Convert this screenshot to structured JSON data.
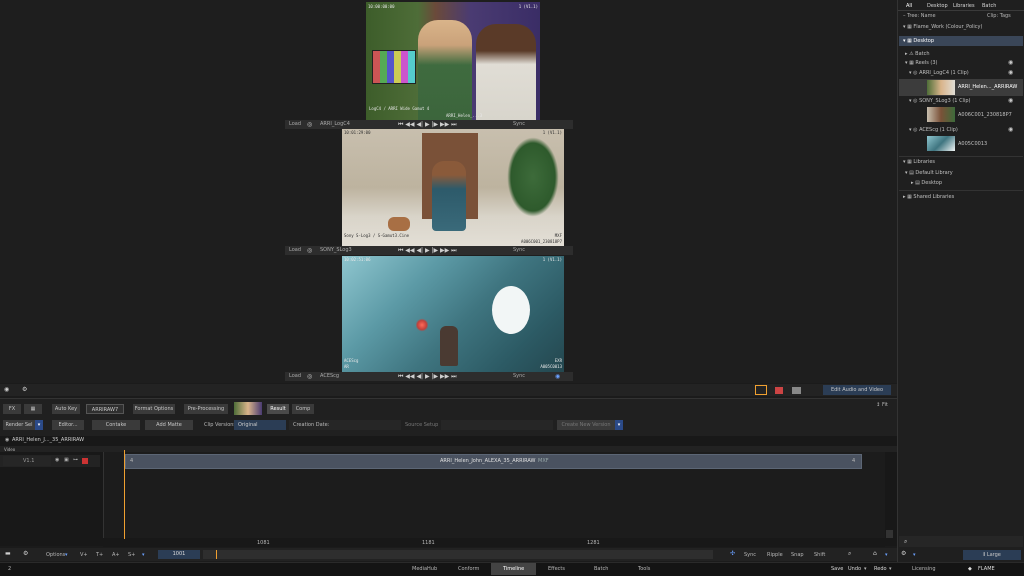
{
  "viewers": [
    {
      "tc_left": "10:00:00:00",
      "tc_right": "1 (V1.1)",
      "caption": "LogC4 / ARRI Wide Gamut 4",
      "bottom_text": "ARRI_Helen_...3",
      "controls": {
        "load": "Load",
        "clip": "ARRI_LogC4",
        "sync": "Sync"
      }
    },
    {
      "tc_left": "10:01:29:00",
      "tc_right": "1 (V1.1)",
      "caption": "Sony S-Log3 / S-Gamut3.Cine",
      "bottom_text": "A006C001_230818P7",
      "badge": "MXF",
      "controls": {
        "load": "Load",
        "clip": "SONY_SLog3",
        "sync": "Sync"
      }
    },
    {
      "tc_left": "10:02:51:06",
      "tc_right": "1 (V1.1)",
      "caption": "ACEScg",
      "caption2": "AR",
      "bottom_text": "A005C0013",
      "badge": "EXR",
      "controls": {
        "load": "Load",
        "clip": "ACEScg",
        "sync": "Sync"
      }
    }
  ],
  "viewer_toolbar": {
    "edit_audio_video": "Edit Audio and Video"
  },
  "editor": {
    "fx": "FX",
    "auto_key": "Auto Key",
    "arriraw": "ARRIRAW7",
    "format_options": "Format Options",
    "pre_processing": "Pre-Processing",
    "result": "Result",
    "comp": "Comp",
    "fit": "Fit",
    "render_sel": "Render Sel",
    "editor": "Editor...",
    "contake": "Contake",
    "add_matte": "Add Matte",
    "clip_versions": "Clip Versions",
    "clip_versions_value": "Original",
    "creation_date": "Creation Date:",
    "source_setup": "Source Setup",
    "create_new_version": "Create New Version"
  },
  "timeline": {
    "clip_title": "ARRI_Helen_J..._35_ARRIRAW",
    "video_label": "Video",
    "track": "V1.1",
    "clip_name": "ARRI_Helen_John_ALEXA_35_ARRIRAW",
    "clip_badge": "MXF",
    "clip_marker_left": "4",
    "clip_marker_right": "4",
    "ruler": [
      "1081",
      "1181",
      "1281"
    ],
    "current_frame": "1001",
    "bottom": {
      "options": "Options",
      "v": "V+",
      "t": "T+",
      "a": "A+",
      "s": "S+",
      "sync": "Sync",
      "ripple": "Ripple",
      "snap": "Snap",
      "shift": "Shift"
    }
  },
  "media_panel": {
    "tabs": [
      "All",
      "Desktop",
      "Libraries",
      "Batch"
    ],
    "tree_label": "Tree: Name",
    "clip_tags": "Clip: Tags",
    "project": "Flame_Work (Colour_Policy)",
    "desktop": "Desktop",
    "batch": "Batch",
    "reels": "Reels (3)",
    "reel1": "ARRI_LogC4 (1 Clip)",
    "reel1_clip": "ARRI_Helen..._ARRIRAW",
    "reel2": "SONY_SLog3 (1 Clip)",
    "reel2_clip": "A006C001_230818P7",
    "reel3": "ACEScg (1 Clip)",
    "reel3_clip": "A005C0013",
    "libraries": "Libraries",
    "default_library": "Default Library",
    "library_desktop": "Desktop",
    "shared_libraries": "Shared Libraries",
    "size": "Large"
  },
  "bottom_bar": {
    "left": "2",
    "tabs": [
      "MediaHub",
      "Conform",
      "Timeline",
      "Effects",
      "Batch",
      "Tools"
    ],
    "active_tab": "Timeline",
    "save": "Save",
    "undo": "Undo",
    "redo": "Redo",
    "licensing": "Licensing",
    "brand": "FLAME"
  },
  "colors": {
    "accent": "#f0a030",
    "active_tab_bg": "#444444",
    "clip_bar": "#4a5260",
    "blue_field": "#2b3d55"
  }
}
